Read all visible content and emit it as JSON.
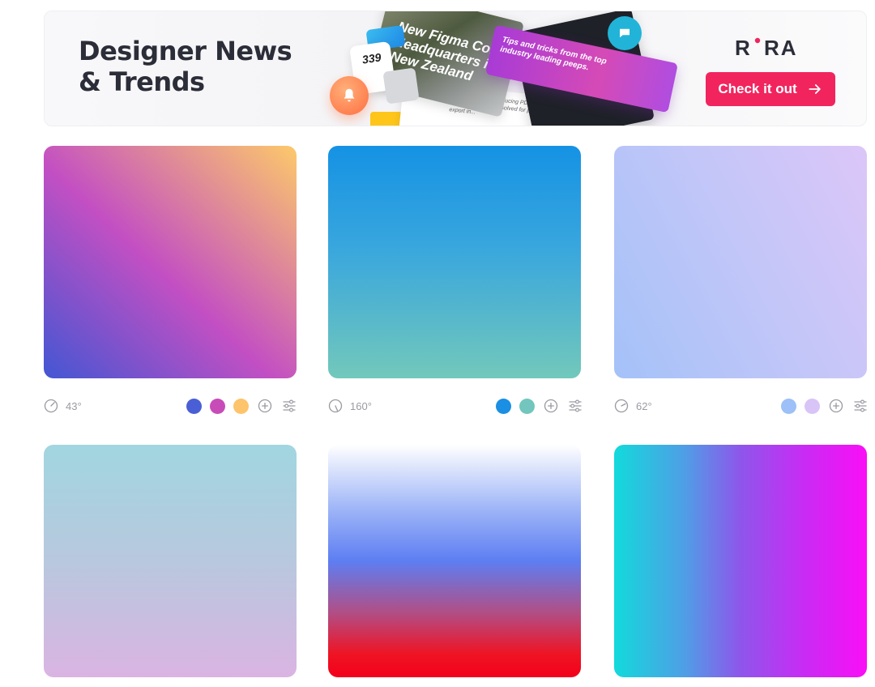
{
  "banner": {
    "title_line1": "Designer News",
    "title_line2": "& Trends",
    "brand": "RORA",
    "cta_label": "Check it out",
    "collage": {
      "headline": "New Figma Co. Headquarters in New Zealand",
      "tip_text": "Tips and tricks from the top industry leading peeps.",
      "count": "339",
      "doc_text": "Details matter - Introducing PDF Export in Figma. See how we solved for precision export in..."
    },
    "cta_color": "#f2245e"
  },
  "gradients": [
    {
      "angle": "43°",
      "colors": [
        "#4a5fd6",
        "#c84cb8",
        "#fdc46b"
      ],
      "css": "linear-gradient(43deg, #4356d3 0%, #c34fc3 46%, #fdc96a 100%)"
    },
    {
      "angle": "160°",
      "colors": [
        "#1a8fe3",
        "#72c6bd"
      ],
      "css": "linear-gradient(180deg, #1592e4 0%, #3aa7dd 45%, #72c8bb 100%)"
    },
    {
      "angle": "62°",
      "colors": [
        "#9cc0f7",
        "#d8c4f6"
      ],
      "css": "linear-gradient(62deg, #a4c2f8 0%, #c4c6f8 55%, #dcc6f8 100%)"
    },
    {
      "angle": "",
      "colors": [
        "#a4d4dc",
        "#d9b5e2"
      ],
      "css": "linear-gradient(180deg, #a1d6e0 0%, #b8c8de 50%, #dab4e2 100%)"
    },
    {
      "angle": "",
      "colors": [
        "#ffffff",
        "#5a7ff0",
        "#f4001c"
      ],
      "css": "linear-gradient(180deg, #ffffff 0%, #9db4f7 28%, #5d7ef2 50%, #b04f86 72%, #ef1424 90%, #f3001a 100%)"
    },
    {
      "angle": "",
      "colors": [
        "#13dcdc",
        "#f70af7"
      ],
      "css": "linear-gradient(90deg, #12dadb 0%, #4f9ee6 28%, #8e56eb 50%, #c82cf4 75%, #fa0ef6 100%)"
    }
  ]
}
